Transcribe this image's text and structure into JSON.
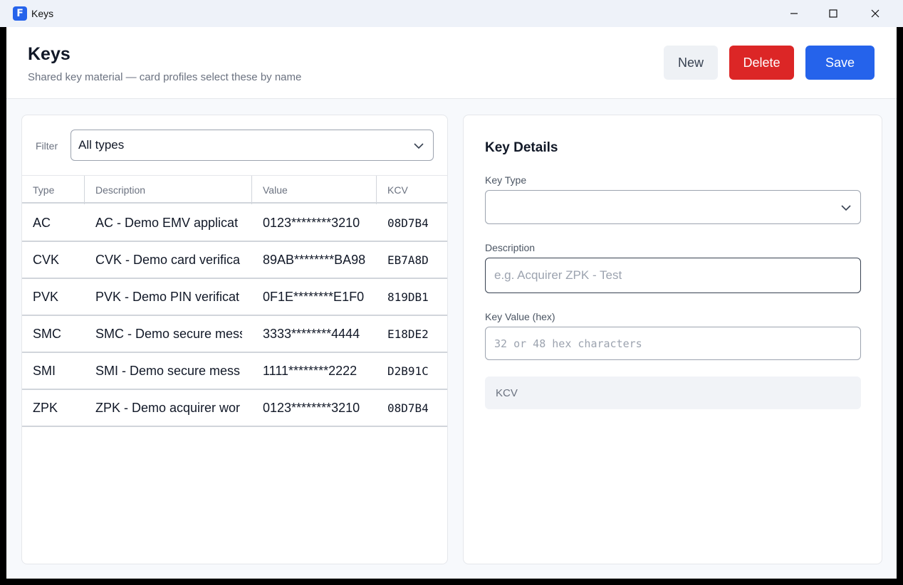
{
  "window": {
    "title": "Keys",
    "app_icon_letter": "F"
  },
  "header": {
    "title": "Keys",
    "subtitle": "Shared key material — card profiles select these by name",
    "buttons": {
      "new_label": "New",
      "delete_label": "Delete",
      "save_label": "Save"
    }
  },
  "colors": {
    "accent": "#2563eb",
    "danger": "#dc2626"
  },
  "filter": {
    "label": "Filter",
    "selected": "All types"
  },
  "table": {
    "columns": [
      "Type",
      "Description",
      "Value",
      "KCV"
    ],
    "rows": [
      {
        "type": "AC",
        "description": "AC - Demo EMV applicat",
        "value": "0123********3210",
        "kcv": "08D7B4"
      },
      {
        "type": "CVK",
        "description": "CVK - Demo card verifica",
        "value": "89AB********BA98",
        "kcv": "EB7A8D"
      },
      {
        "type": "PVK",
        "description": "PVK - Demo PIN verificat",
        "value": "0F1E********E1F0",
        "kcv": "819DB1"
      },
      {
        "type": "SMC",
        "description": "SMC - Demo secure mess",
        "value": "3333********4444",
        "kcv": "E18DE2"
      },
      {
        "type": "SMI",
        "description": "SMI - Demo secure mess",
        "value": "1111********2222",
        "kcv": "D2B91C"
      },
      {
        "type": "ZPK",
        "description": "ZPK - Demo acquirer wor",
        "value": "0123********3210",
        "kcv": "08D7B4"
      }
    ]
  },
  "details": {
    "title": "Key Details",
    "key_type": {
      "label": "Key Type",
      "value": ""
    },
    "description": {
      "label": "Description",
      "placeholder": "e.g. Acquirer ZPK - Test"
    },
    "key_value": {
      "label": "Key Value (hex)",
      "placeholder": "32 or 48 hex characters"
    },
    "kcv": {
      "label": "KCV"
    }
  }
}
